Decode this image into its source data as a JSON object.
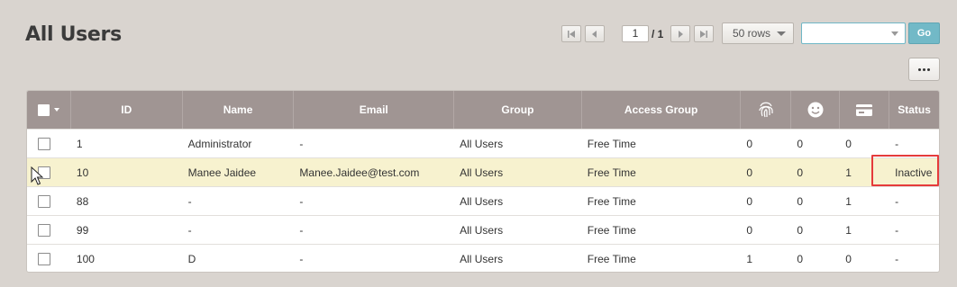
{
  "page": {
    "title": "All Users"
  },
  "pager": {
    "current_page": "1",
    "total": "/ 1"
  },
  "rows_select": {
    "label": "50 rows"
  },
  "search": {
    "value": ""
  },
  "go_button": {
    "label": "Go"
  },
  "table": {
    "columns": [
      "",
      "ID",
      "Name",
      "Email",
      "Group",
      "Access Group",
      "fingerprint-icon",
      "face-icon",
      "card-icon",
      "Status"
    ],
    "rows": [
      {
        "id": "1",
        "name": "Administrator",
        "email": "-",
        "group": "All Users",
        "access_group": "Free Time",
        "fingerprint": "0",
        "face": "0",
        "card": "0",
        "status": "-"
      },
      {
        "id": "10",
        "name": "Manee Jaidee",
        "email": "Manee.Jaidee@test.com",
        "group": "All Users",
        "access_group": "Free Time",
        "fingerprint": "0",
        "face": "0",
        "card": "1",
        "status": "Inactive"
      },
      {
        "id": "88",
        "name": "-",
        "email": "-",
        "group": "All Users",
        "access_group": "Free Time",
        "fingerprint": "0",
        "face": "0",
        "card": "1",
        "status": "-"
      },
      {
        "id": "99",
        "name": "-",
        "email": "-",
        "group": "All Users",
        "access_group": "Free Time",
        "fingerprint": "0",
        "face": "0",
        "card": "1",
        "status": "-"
      },
      {
        "id": "100",
        "name": "D",
        "email": "-",
        "group": "All Users",
        "access_group": "Free Time",
        "fingerprint": "1",
        "face": "0",
        "card": "0",
        "status": "-"
      }
    ]
  },
  "colors": {
    "header_bg": "#a09593",
    "highlight_row": "#f7f2cf",
    "accent": "#72b9c7",
    "annotation": "#e53b3b"
  }
}
